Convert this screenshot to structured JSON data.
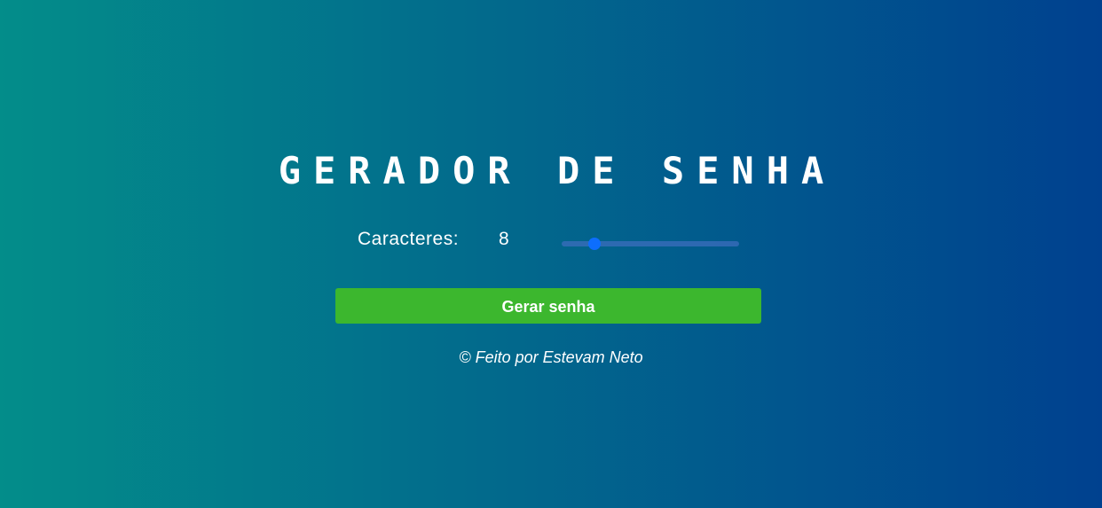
{
  "header": {
    "title": "GERADOR DE SENHA"
  },
  "generator": {
    "length_label": "Caracteres:",
    "length_value": "8",
    "slider": {
      "min": 1,
      "max": 50,
      "value": 8,
      "track_color": "#3c6ebe",
      "thumb_color": "#0d6efd"
    },
    "generate_button_label": "Gerar senha",
    "button_color": "#3cb72e"
  },
  "footer": {
    "credit": "© Feito por Estevam Neto"
  },
  "theme": {
    "gradient_start": "#038d8a",
    "gradient_end": "#00418f"
  }
}
